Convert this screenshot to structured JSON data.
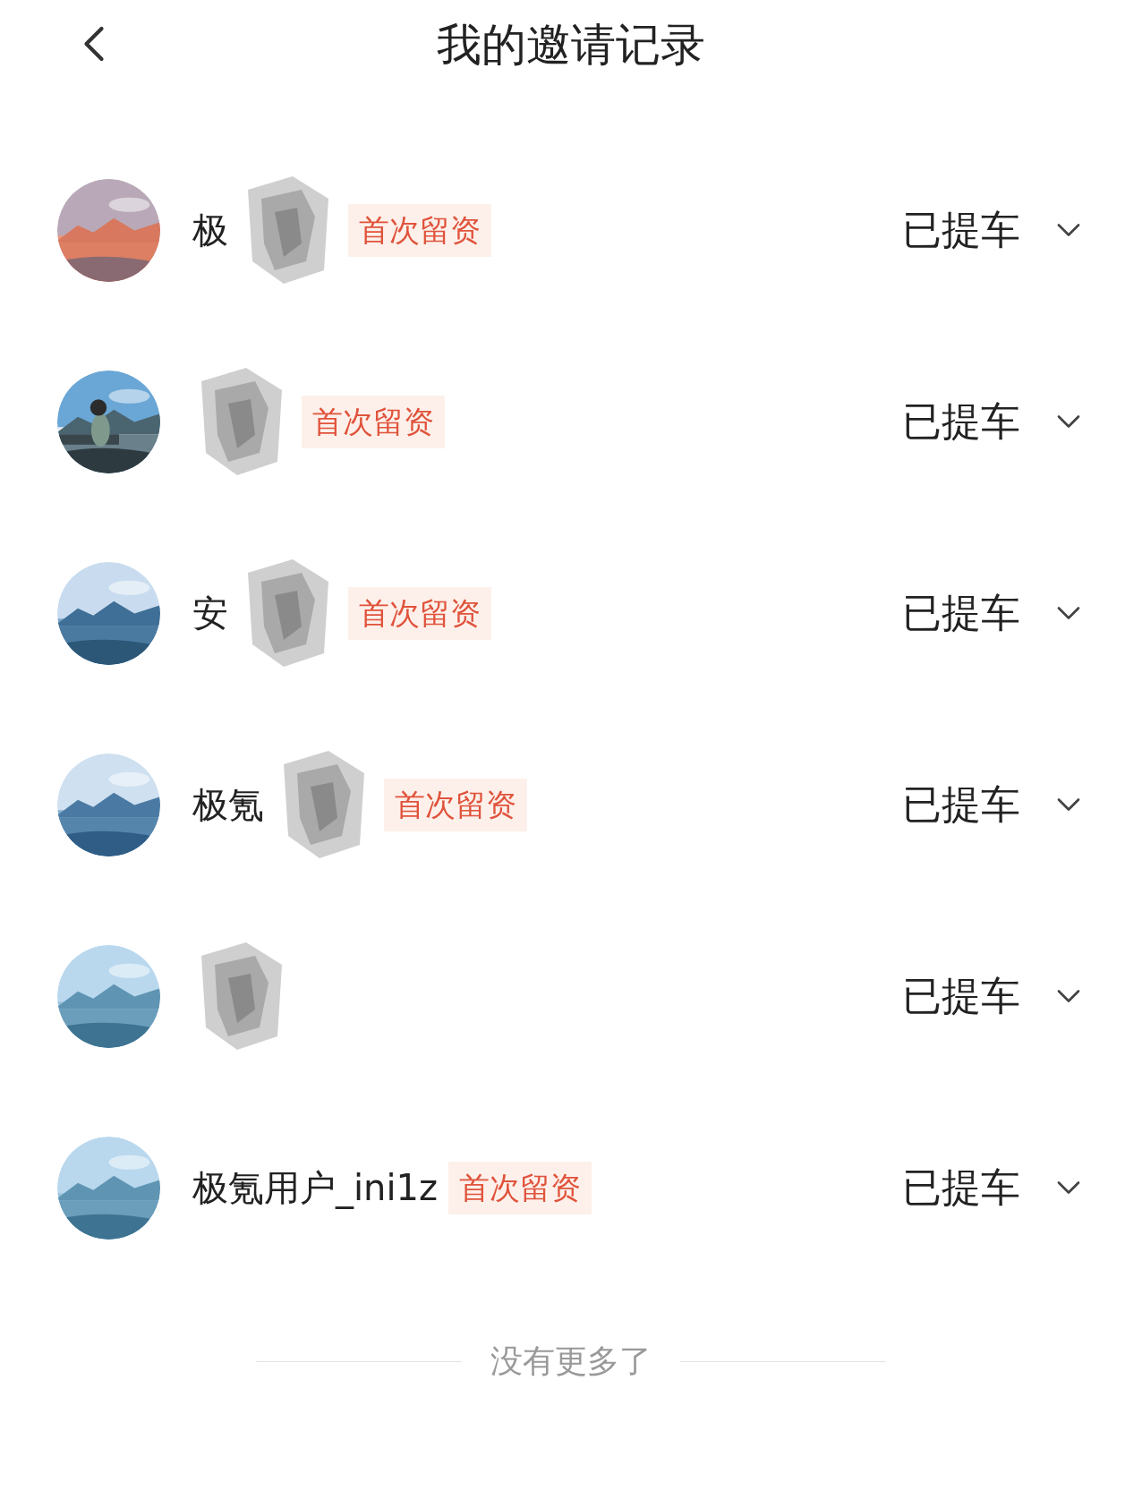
{
  "header": {
    "title": "我的邀请记录"
  },
  "invites": [
    {
      "name": "极",
      "redacted": true,
      "tag": "首次留资",
      "status": "已提车",
      "expanded": false
    },
    {
      "redacted": true,
      "tag": "首次留资",
      "status": "已提车",
      "expanded": false
    },
    {
      "name": "安",
      "redacted": true,
      "tag": "首次留资",
      "status": "已提车",
      "expanded": false
    },
    {
      "name": "极氪",
      "redacted": true,
      "tag": "首次留资",
      "status": "已提车",
      "expanded": false
    },
    {
      "redacted": true,
      "status": "已提车",
      "expanded": false
    },
    {
      "name": "极氪用户_ini1z",
      "redacted": false,
      "tag": "首次留资",
      "status": "已提车",
      "expanded": false
    }
  ],
  "footer": "没有更多了"
}
